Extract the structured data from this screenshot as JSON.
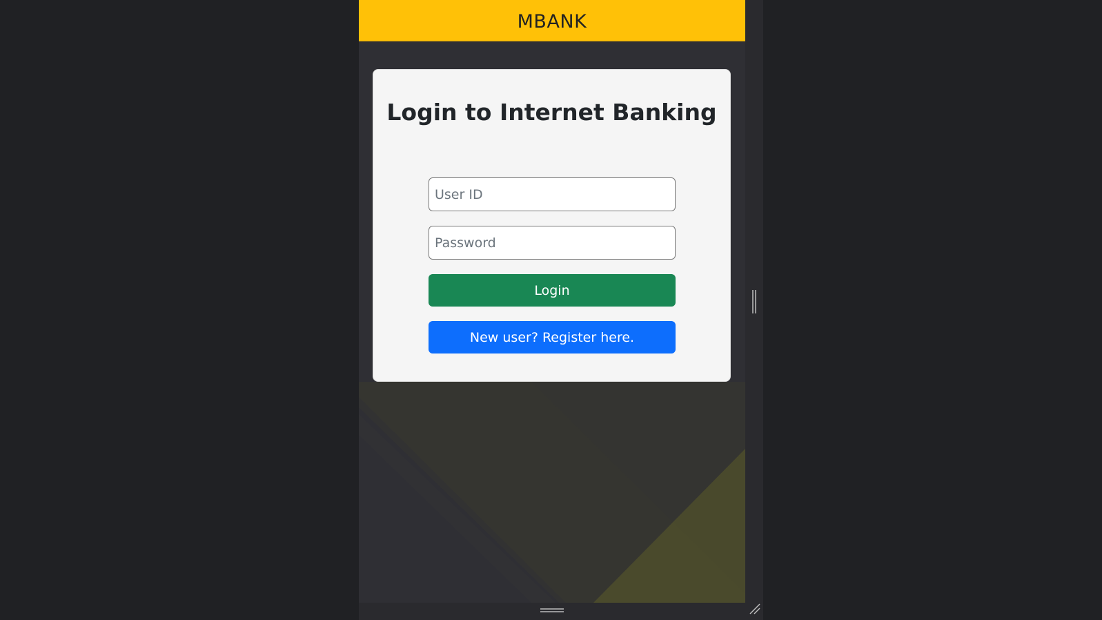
{
  "navbar": {
    "brand": "MBANK",
    "color": "#ffc107"
  },
  "login_card": {
    "title": "Login to Internet Banking",
    "user_id": {
      "placeholder": "User ID",
      "value": ""
    },
    "password": {
      "placeholder": "Password",
      "value": ""
    },
    "login_button": {
      "label": "Login",
      "color": "#198754"
    },
    "register_button": {
      "label": "New user? Register here.",
      "color": "#0d6efd"
    }
  },
  "device_frame": {
    "drag_handle_icon": "horizontal-drag-handle-icon",
    "side_handle_icon": "vertical-drag-handle-icon",
    "resize_icon": "resize-corner-icon"
  }
}
